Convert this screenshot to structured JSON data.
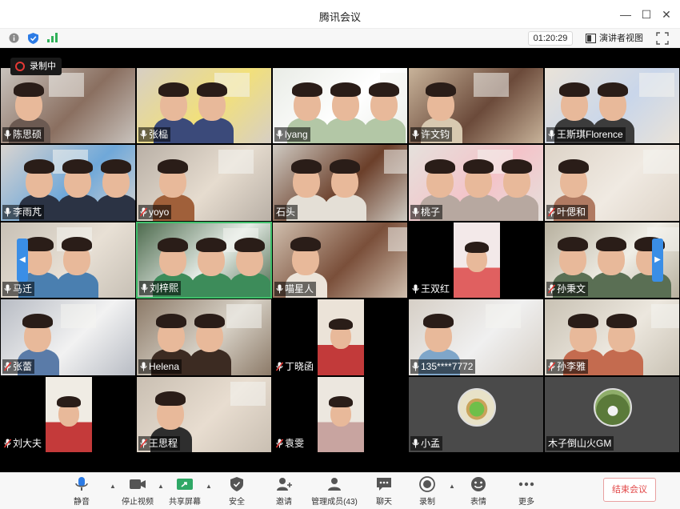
{
  "window": {
    "title": "腾讯会议"
  },
  "infobar": {
    "timer": "01:20:29",
    "speaker_view_label": "演讲者视图",
    "icons": [
      "info-icon",
      "shield-icon",
      "signal-icon",
      "speaker-view-icon",
      "fullscreen-icon"
    ]
  },
  "recording_badge": "录制中",
  "participants": [
    {
      "name": "陈思硕",
      "mic": "on"
    },
    {
      "name": "张榀",
      "mic": "on"
    },
    {
      "name": "lyang",
      "mic": "on"
    },
    {
      "name": "许文钧",
      "mic": "on"
    },
    {
      "name": "王斯琪Florence",
      "mic": "on"
    },
    {
      "name": "李雨芃",
      "mic": "on"
    },
    {
      "name": "yoyo",
      "mic": "muted"
    },
    {
      "name": "石头",
      "mic": "none"
    },
    {
      "name": "桃子",
      "mic": "on"
    },
    {
      "name": "叶偲和",
      "mic": "muted"
    },
    {
      "name": "马迁",
      "mic": "on"
    },
    {
      "name": "刘梓熙",
      "mic": "on"
    },
    {
      "name": "喵星人",
      "mic": "on"
    },
    {
      "name": "王双红",
      "mic": "on"
    },
    {
      "name": "孙秉文",
      "mic": "muted"
    },
    {
      "name": "张蕾",
      "mic": "muted"
    },
    {
      "name": "Helena",
      "mic": "on"
    },
    {
      "name": "丁晓函",
      "mic": "muted"
    },
    {
      "name": "135****7772",
      "mic": "on"
    },
    {
      "name": "孙李雅",
      "mic": "muted"
    },
    {
      "name": "刘大夫",
      "mic": "muted"
    },
    {
      "name": "王思程",
      "mic": "muted"
    },
    {
      "name": "袁雯",
      "mic": "muted"
    },
    {
      "name": "小孟",
      "mic": "on"
    },
    {
      "name": "木子倒山火GM",
      "mic": "none"
    }
  ],
  "toolbar": {
    "mute": "静音",
    "stop_video": "停止视频",
    "share_screen": "共享屏幕",
    "security": "安全",
    "invite": "邀请",
    "manage_members": "管理成员(43)",
    "chat": "聊天",
    "record": "录制",
    "reactions": "表情",
    "more": "更多",
    "end_meeting": "结束会议"
  },
  "colors": {
    "accent_blue": "#2c7be5",
    "end_red": "#e24848",
    "active_speaker_green": "#3fbf6a",
    "muted_red": "#e53935"
  }
}
